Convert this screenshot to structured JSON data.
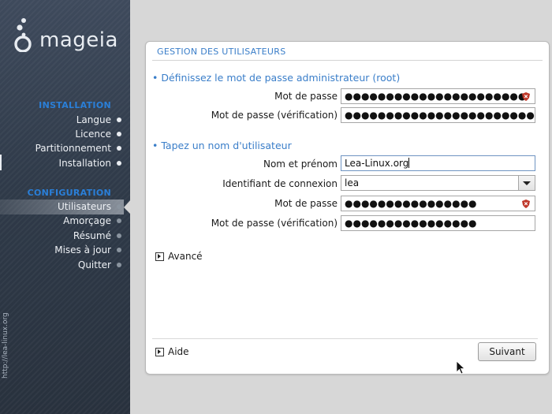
{
  "sidebar": {
    "brand": "mageia",
    "watermark": "http://lea-linux.org",
    "sections": [
      {
        "title": "INSTALLATION",
        "items": [
          "Langue",
          "Licence",
          "Partitionnement",
          "Installation"
        ]
      },
      {
        "title": "CONFIGURATION",
        "items": [
          "Utilisateurs",
          "Amorçage",
          "Résumé",
          "Mises à jour",
          "Quitter"
        ]
      }
    ],
    "active_item": "Utilisateurs"
  },
  "panel": {
    "title": "GESTION DES UTILISATEURS",
    "root_group": {
      "title": "• Définissez le mot de passe administrateur (root)",
      "password_label": "Mot de passe",
      "password_value": "●●●●●●●●●●●●●●●●●●●●●●",
      "verify_label": "Mot de passe (vérification)",
      "verify_value": "●●●●●●●●●●●●●●●●●●●●●●●"
    },
    "user_group": {
      "title": "• Tapez un nom d'utilisateur",
      "fullname_label": "Nom et prénom",
      "fullname_value": "Lea-Linux.org",
      "login_label": "Identifiant de connexion",
      "login_value": "lea",
      "password_label": "Mot de passe",
      "password_value": "●●●●●●●●●●●●●●●●",
      "verify_label": "Mot de passe (vérification)",
      "verify_value": "●●●●●●●●●●●●●●●●"
    },
    "advanced_label": "Avancé",
    "help_label": "Aide",
    "next_label": "Suivant"
  },
  "icons": {
    "weak_password": "shield-icon",
    "expander": "expander-triangle-icon"
  },
  "colors": {
    "accent": "#3a7ec9",
    "section_title": "#2a7fd8",
    "weak_indicator": "#c0392b"
  }
}
